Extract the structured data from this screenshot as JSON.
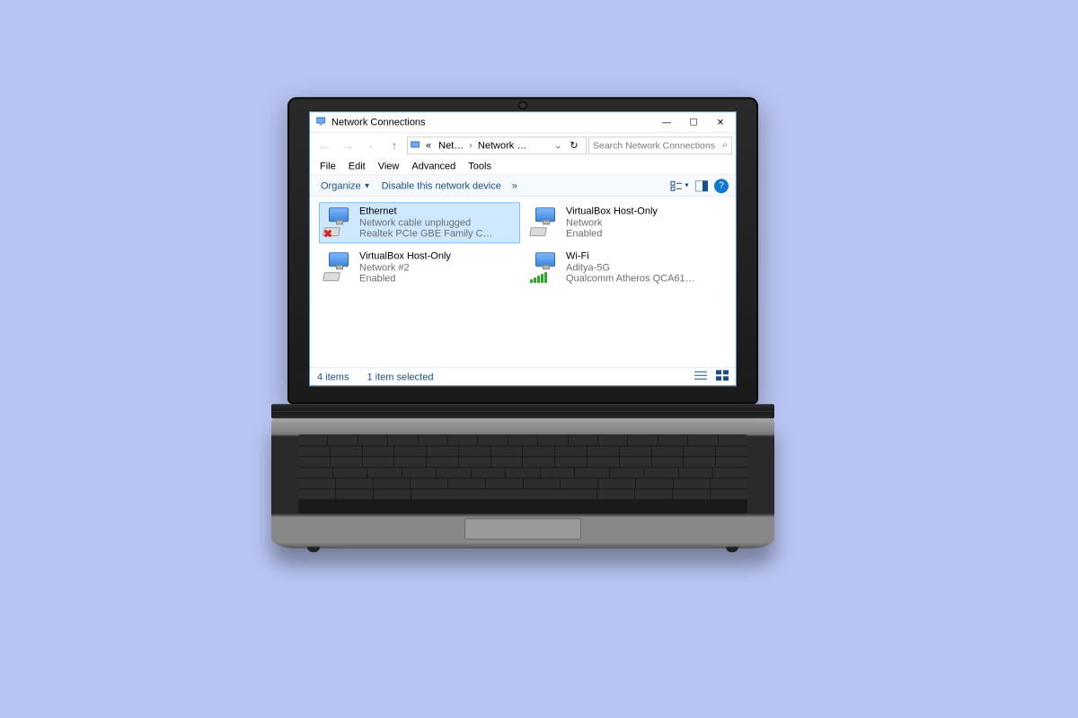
{
  "window": {
    "title": "Network Connections",
    "controls": {
      "min": "—",
      "max": "☐",
      "close": "✕"
    }
  },
  "nav": {
    "breadcrumb_prefix": "«",
    "breadcrumb_seg1": "Net…",
    "breadcrumb_seg2": "Network …",
    "refresh_glyph": "↻",
    "search_placeholder": "Search Network Connections",
    "search_icon": "⌕"
  },
  "menus": [
    "File",
    "Edit",
    "View",
    "Advanced",
    "Tools"
  ],
  "cmdbar": {
    "organize": "Organize",
    "disable": "Disable this network device",
    "chev": "»",
    "help": "?"
  },
  "items": [
    {
      "name": "Ethernet",
      "status": "Network cable unplugged",
      "device": "Realtek PCIe GBE Family C…",
      "selected": true,
      "icon": "ethernet-error"
    },
    {
      "name": "VirtualBox Host-Only",
      "status": "Network",
      "device": "Enabled",
      "selected": false,
      "icon": "ethernet"
    },
    {
      "name": "VirtualBox Host-Only",
      "status": "Network #2",
      "device": "Enabled",
      "selected": false,
      "icon": "ethernet"
    },
    {
      "name": "Wi-Fi",
      "status": "Aditya-5G",
      "device": "Qualcomm Atheros QCA61…",
      "selected": false,
      "icon": "wifi"
    }
  ],
  "statusbar": {
    "count": "4 items",
    "selected": "1 item selected"
  }
}
